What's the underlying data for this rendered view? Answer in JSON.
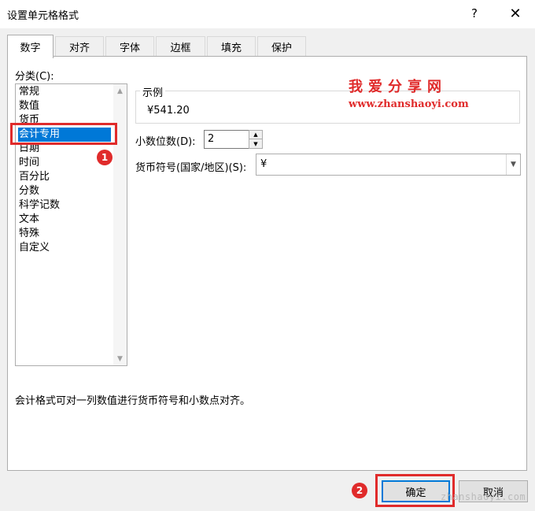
{
  "window": {
    "title": "设置单元格格式",
    "help_label": "?",
    "close_label": "✕"
  },
  "tabs": [
    {
      "label": "数字",
      "active": true
    },
    {
      "label": "对齐"
    },
    {
      "label": "字体"
    },
    {
      "label": "边框"
    },
    {
      "label": "填充"
    },
    {
      "label": "保护"
    }
  ],
  "category": {
    "label": "分类(C):",
    "items": [
      "常规",
      "数值",
      "货币",
      "会计专用",
      "日期",
      "时间",
      "百分比",
      "分数",
      "科学记数",
      "文本",
      "特殊",
      "自定义"
    ],
    "selected": "会计专用"
  },
  "sample": {
    "title": "示例",
    "value": "¥541.20"
  },
  "decimal_places": {
    "label": "小数位数(D):",
    "value": "2"
  },
  "currency_symbol": {
    "label": "货币符号(国家/地区)(S):",
    "value": "¥"
  },
  "description": "会计格式可对一列数值进行货币符号和小数点对齐。",
  "buttons": {
    "ok": "确定",
    "cancel": "取消"
  },
  "annotations": {
    "badge1": "1",
    "badge2": "2",
    "color": "#e02b2b"
  },
  "watermark": {
    "cn": "我爱分享网",
    "url": "www.zhanshaoyi.com",
    "footer": "zhanshaoyi.com"
  },
  "colors": {
    "selection": "#0078d7",
    "dialog_bg": "#f0f0f0"
  }
}
